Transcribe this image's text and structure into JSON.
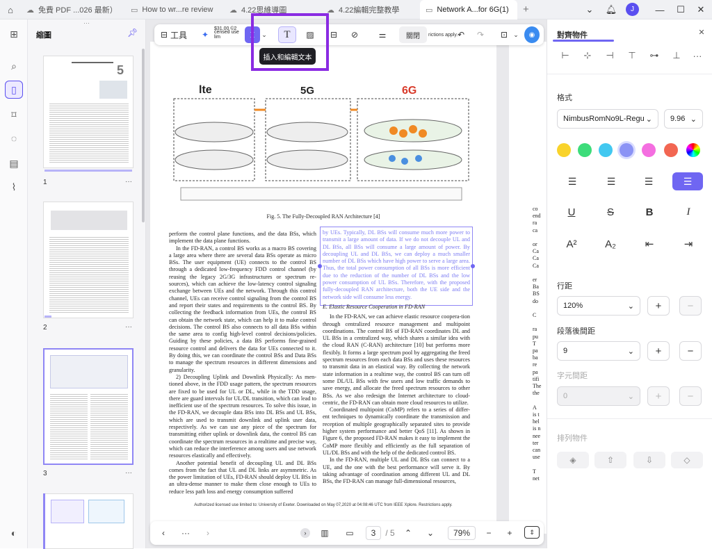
{
  "tabs": [
    {
      "label": "免費 PDF ...026 最新）"
    },
    {
      "label": "How to wr...re review"
    },
    {
      "label": "4.22思維導圖"
    },
    {
      "label": "4.22編輯完整教學"
    },
    {
      "label": "Network A...for 6G(1)"
    }
  ],
  "avatar": "J",
  "thumbnails": {
    "title": "縮圖",
    "pages": [
      "1",
      "2",
      "3"
    ]
  },
  "toolbar": {
    "tools_label": "工具",
    "close_label": "關閉",
    "tooltip": "插入和編輯文本",
    "price": "$31.00 ©2",
    "licensed_frag": "censed use lim",
    "restrict_frag": "rictions apply."
  },
  "figure": {
    "caption": "Fig. 5.  The Fully-Decoupled RAN Architecture [4]",
    "lte": "lte",
    "five_g": "5G",
    "six_g": "6G"
  },
  "doc": {
    "left_col": [
      "perform the control plane functions, and the data BSs, which implement the data plane functions.",
      "In the FD-RAN, a control BS works as a macro BS covering a large area where there are several data BSs operate as micro BSs. The user equipment (UE) connects to the control BS through a dedicated low-frequency FDD control channel (by reusing the legacy 2G/3G infrastructures or spectrum re-sources), which can achieve the low-latency control signaling exchange between UEs and the network. Through this control channel, UEs can receive control signaling from the control BS and report their states and requirements to the control BS. By collecting the feedback information from UEs, the control BS can obtain the network state, which can help it to make control decisions. The control BS also connects to all data BSs within the same area to config high-level control decisions/policies. Guiding by these policies, a data BS performs fine-grained resource control and delivers the data for UEs connected to it. By doing this, we can coordinate the control BSs and Data BSs to manage the spectrum resources in different dimensions and granularity.",
      "2) Decoupling Uplink and Downlink Physically: As men-tioned above, in the FDD usage pattern, the spectrum resources are fixed to be used for UL or DL, while in the TDD usage, there are guard intervals for UL/DL transition, which can lead to inefficient use of the spectrum resources. To solve this issue, in the FD-RAN, we decouple data BSs into DL BSs and UL BSs, which are used to transmit downlink and uplink user data, respectively. As we can use any piece of the spectrum for transmitting either uplink or downlink data, the control BS can coordinate the spectrum resources in a realtime and precise way, which can reduce the interference among users and use network resources elastically and effectively.",
      "Another potential benefit of decoupling UL and DL BSs comes from the fact that UL and DL links are asymmetric. As the power limitation of UEs, FD-RAN should deploy UL BSs in an ultra-dense manner to make them close enough to UEs to reduce less path loss and energy consumption suffered"
    ],
    "selected_text": "by UEs. Typically, DL BSs will consume much more power to transmit a large amount of data. If we do not decouple UL and DL BSs, all BSs will consume a large amount of power. By decoupling UL and DL BSs, we can deploy a much smaller number of DL BSs which have high power to serve a large area. Thus, the total power consumption of all BSs is more efficient due to the reduction of the number of DL BSs and the low power consumption of UL BSs. Therefore, with the proposed fully-decoupled RAN architecture, both the UE side and the network side will consume less energy.",
    "section_heading": "E.  Elastic Resource Cooperation in FD-RAN",
    "right_col": [
      "In the FD-RAN, we can achieve elastic resource coopera-tion through centralized resource management and multipoint coordinations. The control BS of FD-RAN coordinates DL and UL BSs in a centralized way, which shares a similar idea with the cloud RAN (C-RAN) architecture [10] but performs more flexibly. It forms a large spectrum pool by aggregating the freed spectrum resources from each data BSs and uses these resources to transmit data in an elastical way. By collecting the network state information in a realtime way, the control BS can turn off some DL/UL BSs with few users and low traffic demands to save energy, and allocate the freed spectrum resources to other BSs. As we also redesign the Internet architecture to cloud-centric, the FD-RAN can obtain more cloud resources to utilize.",
      "Coordinated multipoint (CoMP) refers to a series of differ-ent techniques to dynamically coordinate the transmission and reception of multiple geographically separated sites to provide higher system performance and better QoS [11]. As shown in Figure 6, the proposed FD-RAN makes it easy to implement the CoMP more flexibly and efficiently as the full separation of UL/DL BSs and with the help of the dedicated control BS.",
      "In the FD-RAN, multiple UL and DL BSs can connect to a UE, and the one with the best performance will serve it. By taking advantage of coordination among different UL and DL BSs, the FD-RAN can manage full-dimensional resources,"
    ],
    "footer": "Authorized licensed use limited to: University of Exeter. Downloaded on May 07,2020 at 04:08:46 UTC from IEEE Xplore.  Restrictions apply.",
    "page2_frag": [
      "co",
      "end",
      "ra",
      "ca",
      "",
      "or",
      "Ca",
      "Ca",
      "Ca",
      "",
      "er",
      "Ba",
      "BS",
      "do",
      "",
      "C",
      "",
      "ra",
      "pu",
      "T",
      "pa",
      "ba",
      "re",
      "pa",
      "tifi",
      "The",
      "the",
      "",
      "A",
      "is t",
      "hel",
      "is n",
      "nee",
      "ter",
      "can",
      "use",
      "",
      "T",
      "net"
    ]
  },
  "bottom": {
    "page": "3",
    "total": "/ 5",
    "zoom": "79%",
    "ellipsis": "···"
  },
  "panel": {
    "title": "對齊物件",
    "format_label": "格式",
    "font": "NimbusRomNo9L-Regu",
    "size": "9.96",
    "colors": [
      "#f9d32b",
      "#3ddc7a",
      "#42c8f0",
      "#8b93f5",
      "#f46ee0",
      "#f26652"
    ],
    "line_spacing_label": "行距",
    "line_spacing": "120%",
    "para_spacing_label": "段落後間距",
    "para_spacing": "9",
    "char_spacing_label": "字元間距",
    "char_spacing": "0",
    "arrange_label": "排列物件"
  }
}
